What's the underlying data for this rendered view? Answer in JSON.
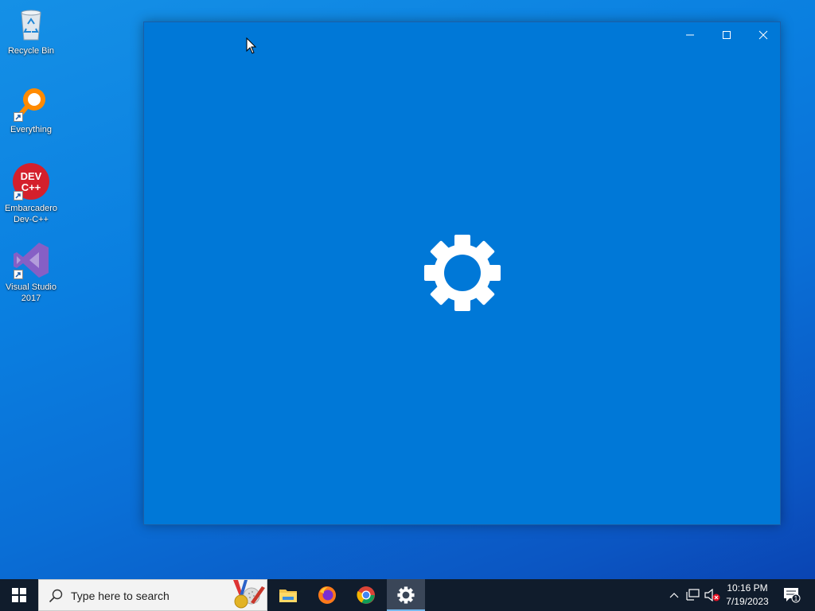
{
  "desktop": {
    "icons": [
      {
        "label": "Recycle Bin"
      },
      {
        "label": "Everything"
      },
      {
        "label": "Embarcadero Dev-C++"
      },
      {
        "label": "Visual Studio 2017"
      }
    ]
  },
  "window": {
    "icon": "gear-icon",
    "accent": "#0078d7"
  },
  "taskbar": {
    "search_placeholder": "Type here to search",
    "apps": [
      "file-explorer-icon",
      "firefox-icon",
      "chrome-icon",
      "settings-gear-icon"
    ],
    "clock": {
      "time": "10:16 PM",
      "date": "7/19/2023"
    },
    "notification_count": "1"
  },
  "colors": {
    "taskbar": "#101c2c",
    "window_bg": "#0078d7"
  }
}
